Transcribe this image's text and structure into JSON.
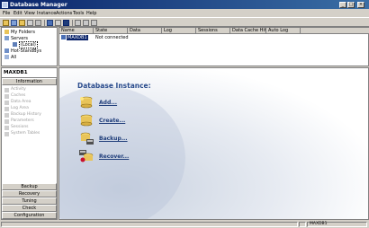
{
  "window": {
    "title": "Database Manager"
  },
  "title_buttons": {
    "minimize": "_",
    "maximize": "□",
    "close": "×"
  },
  "menu": [
    "File",
    "Edit",
    "View",
    "Instance",
    "Actions",
    "Tools",
    "Help"
  ],
  "tree": {
    "items": [
      {
        "label": "My Folders",
        "icon": "folder-icon"
      },
      {
        "label": "Servers",
        "icon": "server-icon"
      },
      {
        "label": "(Local)",
        "icon": "computer-icon",
        "selected": true
      },
      {
        "label": "Hot-StandBys",
        "icon": "standby-icon"
      },
      {
        "label": "All",
        "icon": "all-icon"
      }
    ]
  },
  "list": {
    "columns": [
      "Name",
      "State",
      "Data",
      "Log",
      "Sessions",
      "Data Cache Hit...",
      "Auto Log"
    ],
    "rows": [
      {
        "name": "MAXDB1",
        "state": "Not connected",
        "data": "",
        "log": "",
        "sessions": "",
        "cache": "",
        "autolog": ""
      }
    ]
  },
  "instance": {
    "name": "MAXDB1",
    "info_tab": "Information",
    "nav_items": [
      {
        "label": "Activity",
        "icon": "activity-icon"
      },
      {
        "label": "Caches",
        "icon": "caches-icon"
      },
      {
        "label": "Data Area",
        "icon": "data-area-icon"
      },
      {
        "label": "Log Area",
        "icon": "log-area-icon"
      },
      {
        "label": "Backup History",
        "icon": "backup-history-icon"
      },
      {
        "label": "Parameters",
        "icon": "parameters-icon"
      },
      {
        "label": "Sessions",
        "icon": "sessions-icon"
      },
      {
        "label": "System Tables",
        "icon": "system-tables-icon"
      }
    ],
    "bottom_tabs": [
      "Backup",
      "Recovery",
      "Tuning",
      "Check",
      "Configuration"
    ]
  },
  "main": {
    "title": "Database Instance:",
    "actions": [
      {
        "label": "Add...",
        "icon": "add-database-icon"
      },
      {
        "label": "Create...",
        "icon": "create-database-icon"
      },
      {
        "label": "Backup...",
        "icon": "backup-database-icon"
      },
      {
        "label": "Recover...",
        "icon": "recover-database-icon"
      }
    ]
  },
  "status": {
    "instance": "MAXDB1"
  },
  "colors": {
    "title_start": "#0a246a",
    "title_end": "#3a6ea5",
    "link": "#1f3d7a",
    "heading": "#2a4c8d"
  }
}
